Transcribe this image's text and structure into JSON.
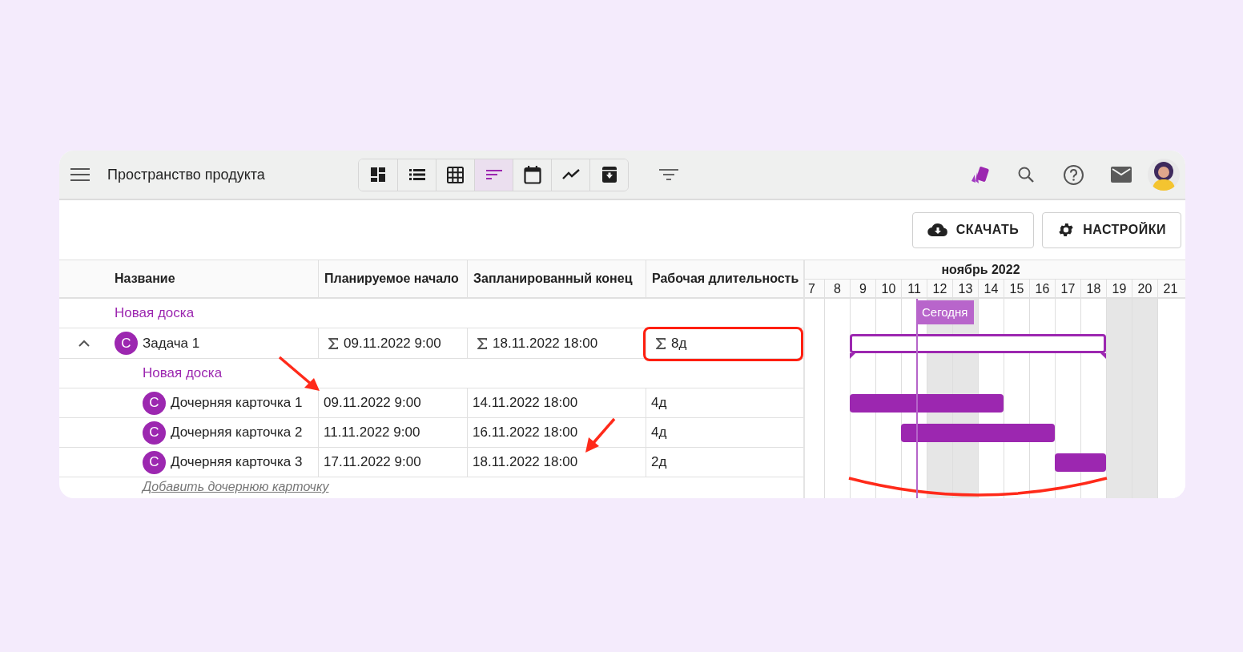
{
  "toolbar": {
    "title": "Пространство продукта",
    "views": [
      {
        "kind": "dashboard",
        "selected": false
      },
      {
        "kind": "list",
        "selected": false
      },
      {
        "kind": "grid",
        "selected": false
      },
      {
        "kind": "gantt",
        "selected": true
      },
      {
        "kind": "calendar",
        "selected": false
      },
      {
        "kind": "chart",
        "selected": false
      },
      {
        "kind": "archive",
        "selected": false
      }
    ]
  },
  "actions": [
    {
      "kind": "download",
      "label": "СКАЧАТЬ"
    },
    {
      "kind": "settings",
      "label": "НАСТРОЙКИ"
    }
  ],
  "table": {
    "columns": [
      "Название",
      "Планируемое начало",
      "Запланированный конец",
      "Рабочая длительность"
    ],
    "rows": [
      {
        "kind": "board",
        "title": "Новая доска"
      },
      {
        "kind": "task",
        "avatar": "С",
        "name": "Задача 1",
        "start": "09.11.2022 9:00",
        "end": "18.11.2022 18:00",
        "duration": "8д",
        "summary": true,
        "expanded": true,
        "highlighted": true,
        "children": [
          {
            "kind": "board",
            "title": "Новая доска"
          },
          {
            "kind": "task",
            "avatar": "С",
            "name": "Дочерняя карточка 1",
            "start": "09.11.2022 9:00",
            "end": "14.11.2022 18:00",
            "duration": "4д",
            "summary": false,
            "highlighted": false
          },
          {
            "kind": "task",
            "avatar": "С",
            "name": "Дочерняя карточка 2",
            "start": "11.11.2022 9:00",
            "end": "16.11.2022 18:00",
            "duration": "4д",
            "summary": false,
            "highlighted": false
          },
          {
            "kind": "task",
            "avatar": "С",
            "name": "Дочерняя карточка 3",
            "start": "17.11.2022 9:00",
            "end": "18.11.2022 18:00",
            "duration": "2д",
            "summary": false,
            "highlighted": false
          }
        ]
      }
    ],
    "add_link": "Добавить дочернюю карточку"
  },
  "gantt": {
    "month": "ноябрь 2022",
    "today_label": "Сегодня",
    "days": [
      {
        "label": "7",
        "weekend": false,
        "today": false
      },
      {
        "label": "8",
        "weekend": false,
        "today": false
      },
      {
        "label": "9",
        "weekend": false,
        "today": false
      },
      {
        "label": "10",
        "weekend": false,
        "today": false
      },
      {
        "label": "11",
        "weekend": false,
        "today": true
      },
      {
        "label": "12",
        "weekend": true,
        "today": false
      },
      {
        "label": "13",
        "weekend": true,
        "today": false
      },
      {
        "label": "14",
        "weekend": false,
        "today": false
      },
      {
        "label": "15",
        "weekend": false,
        "today": false
      },
      {
        "label": "16",
        "weekend": false,
        "today": false
      },
      {
        "label": "17",
        "weekend": false,
        "today": false
      },
      {
        "label": "18",
        "weekend": false,
        "today": false
      },
      {
        "label": "19",
        "weekend": true,
        "today": false
      },
      {
        "label": "20",
        "weekend": true,
        "today": false
      },
      {
        "label": "21",
        "weekend": false,
        "today": false
      }
    ]
  }
}
